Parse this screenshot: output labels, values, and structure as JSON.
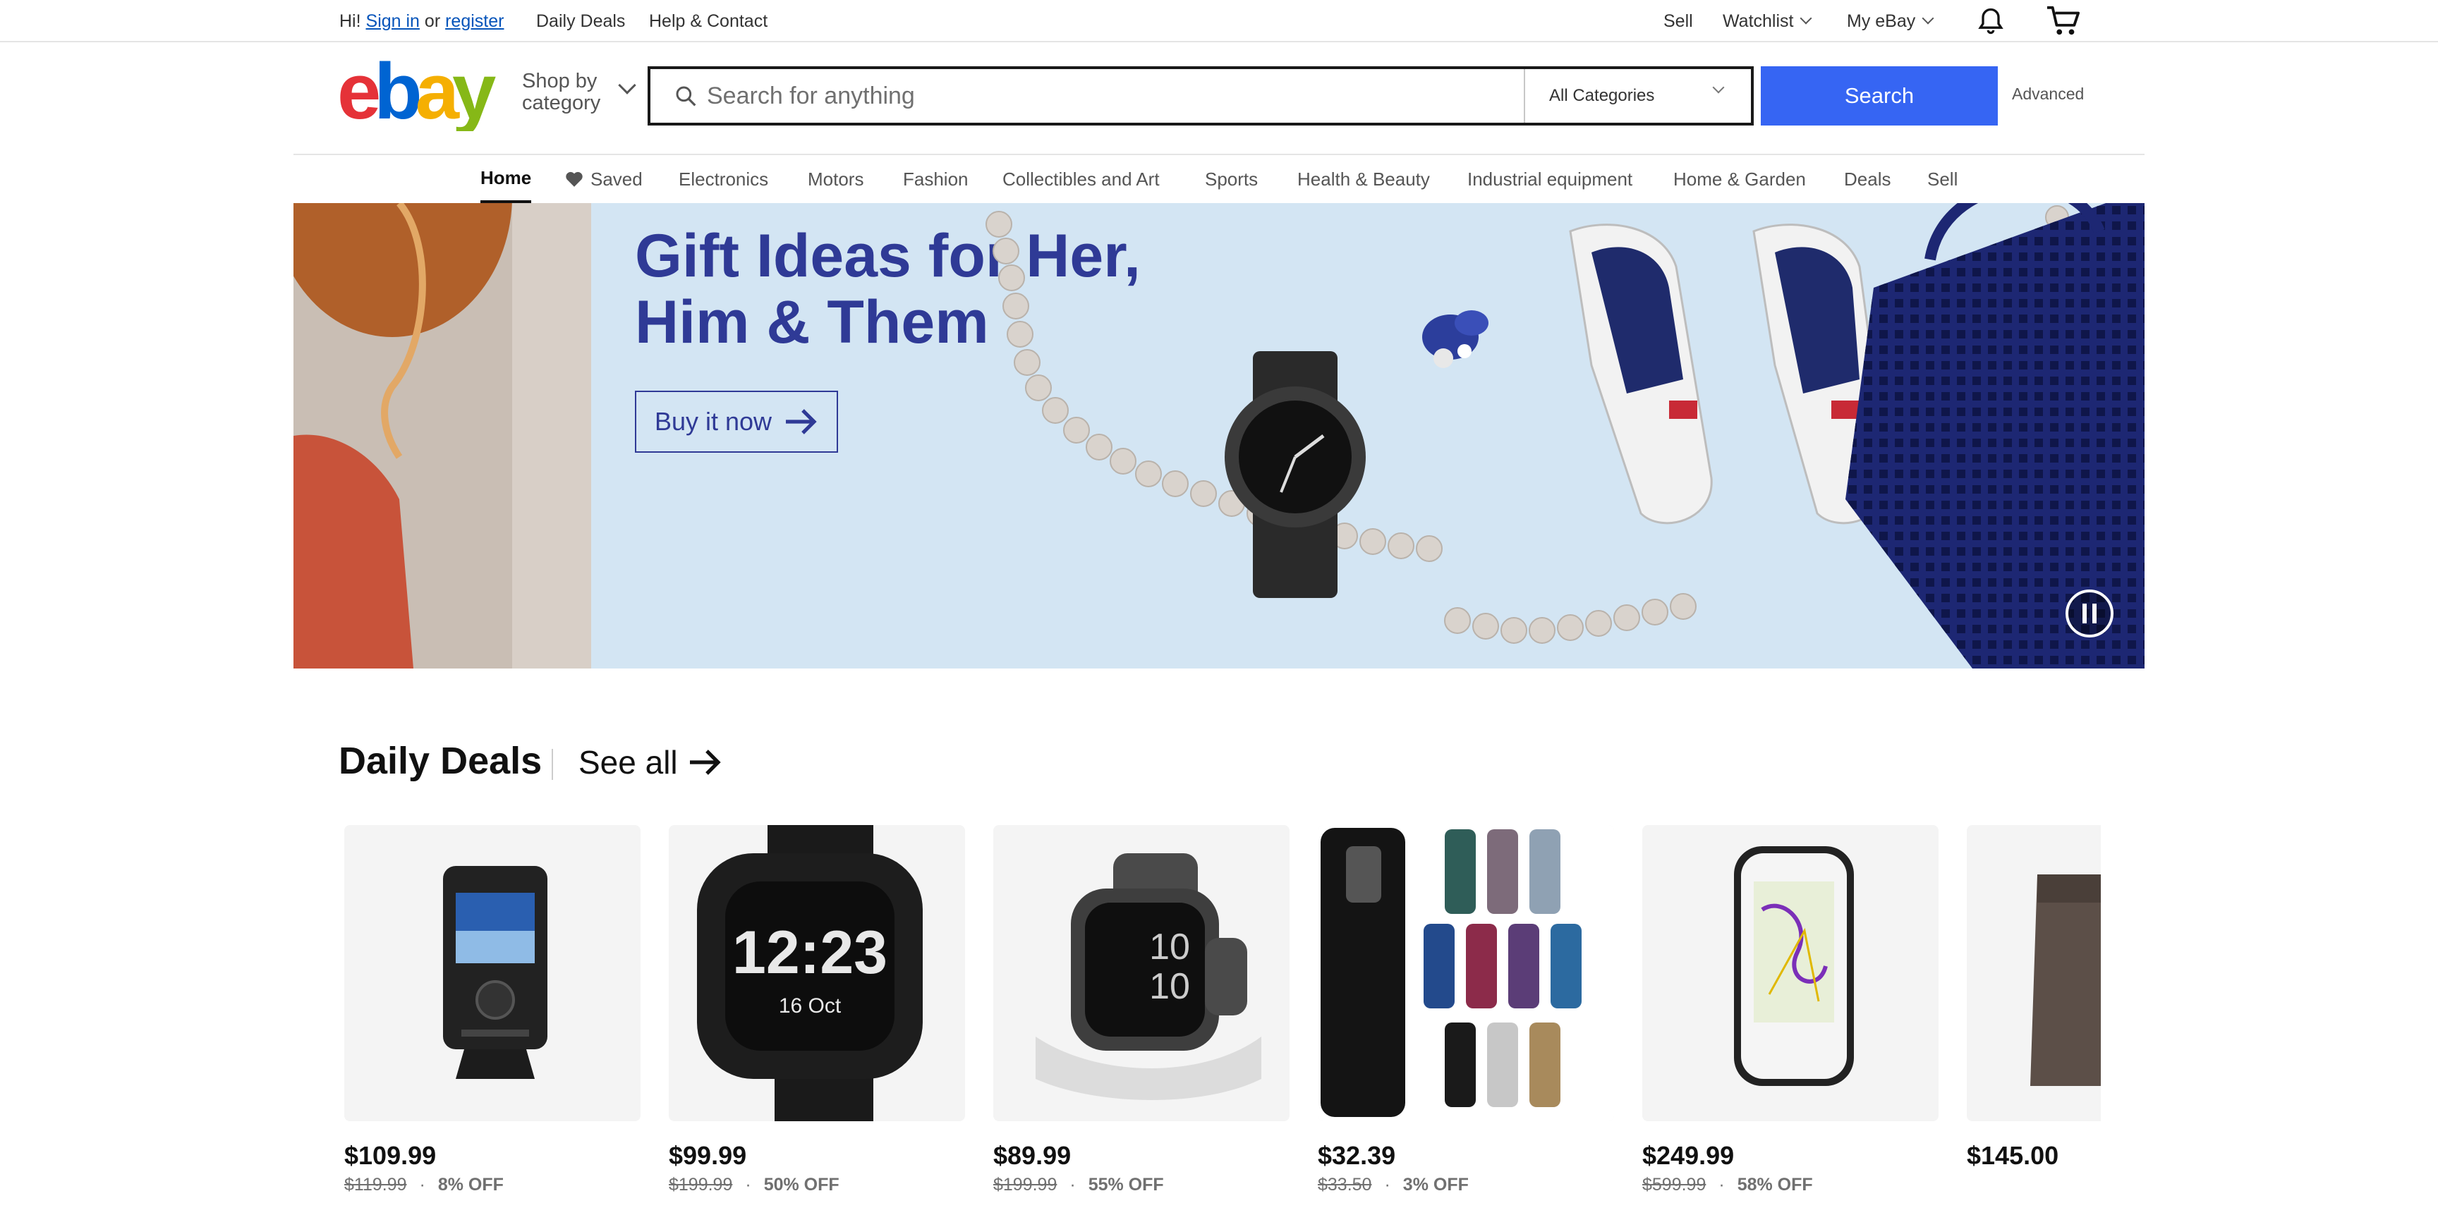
{
  "topbar": {
    "greeting": "Hi!",
    "sign_in": "Sign in",
    "or": "or",
    "register": "register",
    "daily_deals": "Daily Deals",
    "help_contact": "Help & Contact",
    "sell": "Sell",
    "watchlist": "Watchlist",
    "my_ebay": "My eBay"
  },
  "header": {
    "shop_by": "Shop by",
    "category": "category",
    "search_placeholder": "Search for anything",
    "category_select": "All Categories",
    "search_button": "Search",
    "advanced": "Advanced"
  },
  "nav": {
    "items": [
      {
        "label": "Home",
        "active": true
      },
      {
        "label": "Saved"
      },
      {
        "label": "Electronics"
      },
      {
        "label": "Motors"
      },
      {
        "label": "Fashion"
      },
      {
        "label": "Collectibles and Art"
      },
      {
        "label": "Sports"
      },
      {
        "label": "Health & Beauty"
      },
      {
        "label": "Industrial equipment"
      },
      {
        "label": "Home & Garden"
      },
      {
        "label": "Deals"
      },
      {
        "label": "Sell"
      }
    ]
  },
  "hero": {
    "title_line1": "Gift Ideas for Her,",
    "title_line2": "Him & Them",
    "cta": "Buy it now"
  },
  "deals": {
    "title": "Daily Deals",
    "see_all": "See all",
    "items": [
      {
        "product": "fish-finder",
        "price": "$109.99",
        "original": "$119.99",
        "discount": "8% OFF"
      },
      {
        "product": "running-watch",
        "price": "$99.99",
        "original": "$199.99",
        "discount": "50% OFF"
      },
      {
        "product": "smartwatch",
        "price": "$89.99",
        "original": "$199.99",
        "discount": "55% OFF"
      },
      {
        "product": "travel-mugs",
        "price": "$32.39",
        "original": "$33.50",
        "discount": "3% OFF"
      },
      {
        "product": "bike-computer",
        "price": "$249.99",
        "original": "$599.99",
        "discount": "58% OFF"
      },
      {
        "product": "boots",
        "price": "$145.00"
      }
    ]
  },
  "colors": {
    "brand_red": "#e53238",
    "brand_blue": "#0064d2",
    "brand_yellow": "#f5af02",
    "brand_green": "#86b817",
    "search_button": "#3665f3",
    "hero_bg": "#d3e5f3",
    "hero_text": "#2f3a96"
  }
}
